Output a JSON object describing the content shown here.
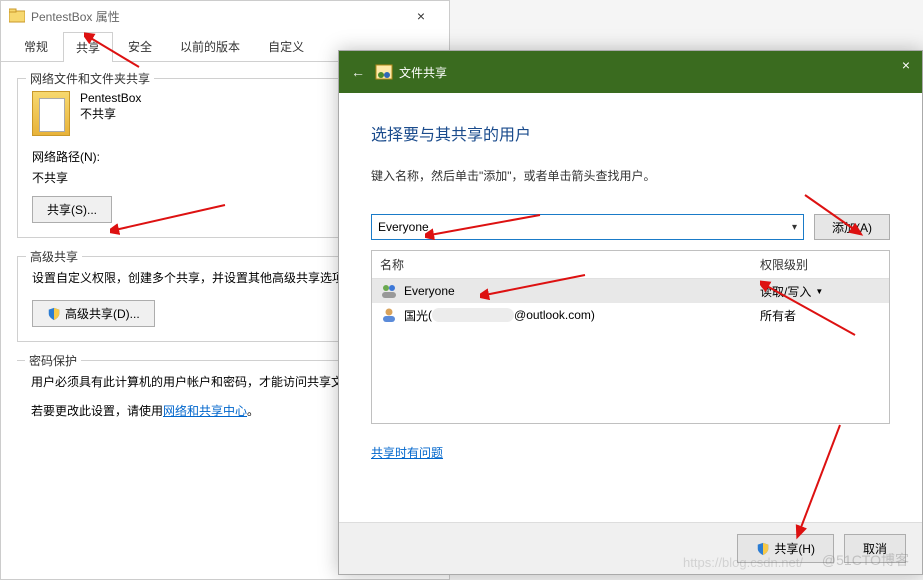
{
  "properties": {
    "title": "PentestBox 属性",
    "tabs": [
      "常规",
      "共享",
      "安全",
      "以前的版本",
      "自定义"
    ],
    "active_tab_index": 1,
    "network_sharing": {
      "group_title": "网络文件和文件夹共享",
      "folder_name": "PentestBox",
      "status": "不共享",
      "path_label": "网络路径(N):",
      "path_value": "不共享",
      "share_button": "共享(S)..."
    },
    "advanced_sharing": {
      "group_title": "高级共享",
      "description": "设置自定义权限，创建多个共享，并设置其他高级共享选项。",
      "button": "高级共享(D)..."
    },
    "password": {
      "group_title": "密码保护",
      "line1": "用户必须具有此计算机的用户帐户和密码，才能访问共享文件夹。",
      "line2_prefix": "若要更改此设置，请使用",
      "line2_link": "网络和共享中心",
      "line2_suffix": "。"
    }
  },
  "wizard": {
    "header_title": "文件共享",
    "heading": "选择要与其共享的用户",
    "description": "键入名称，然后单击\"添加\"，或者单击箭头查找用户。",
    "user_input_value": "Everyone",
    "add_button": "添加(A)",
    "columns": {
      "name": "名称",
      "permission": "权限级别"
    },
    "rows": [
      {
        "name": "Everyone",
        "email": "",
        "perm": "读取/写入",
        "dropdown": true,
        "selected": true,
        "icon": "group"
      },
      {
        "name": "国光",
        "email": "@outlook.com",
        "perm": "所有者",
        "dropdown": false,
        "selected": false,
        "icon": "user"
      }
    ],
    "help_link": "共享时有问题",
    "share_button": "共享(H)",
    "cancel_button": "取消"
  },
  "watermark": "@51CTO博客",
  "watermark_url": "https://blog.csdn.net/"
}
